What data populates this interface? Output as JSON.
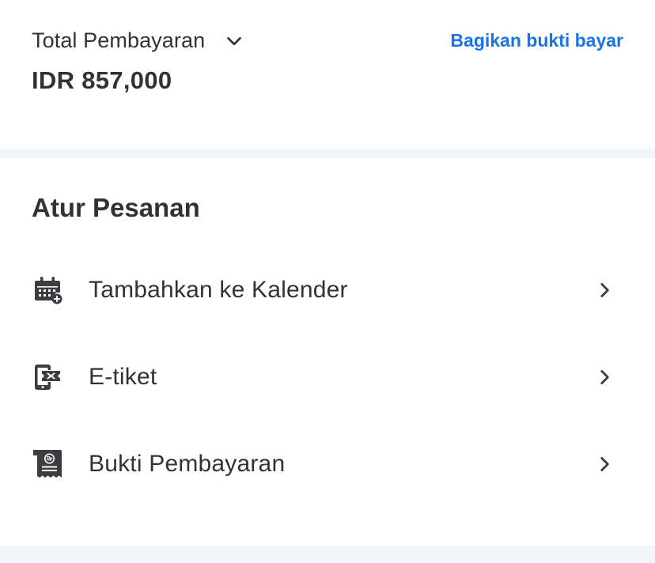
{
  "payment": {
    "total_label": "Total Pembayaran",
    "total_amount": "IDR 857,000",
    "share_label": "Bagikan bukti bayar",
    "expand_icon": "chevron-down-icon"
  },
  "manage": {
    "title": "Atur Pesanan",
    "items": [
      {
        "label": "Tambahkan ke Kalender",
        "icon": "calendar-add-icon"
      },
      {
        "label": "E-tiket",
        "icon": "phone-ticket-icon"
      },
      {
        "label": "Bukti Pembayaran",
        "icon": "receipt-icon"
      }
    ]
  },
  "colors": {
    "text": "#303236",
    "link": "#1a73e8",
    "divider": "#f1f4f9",
    "icon": "#3b3d41"
  }
}
